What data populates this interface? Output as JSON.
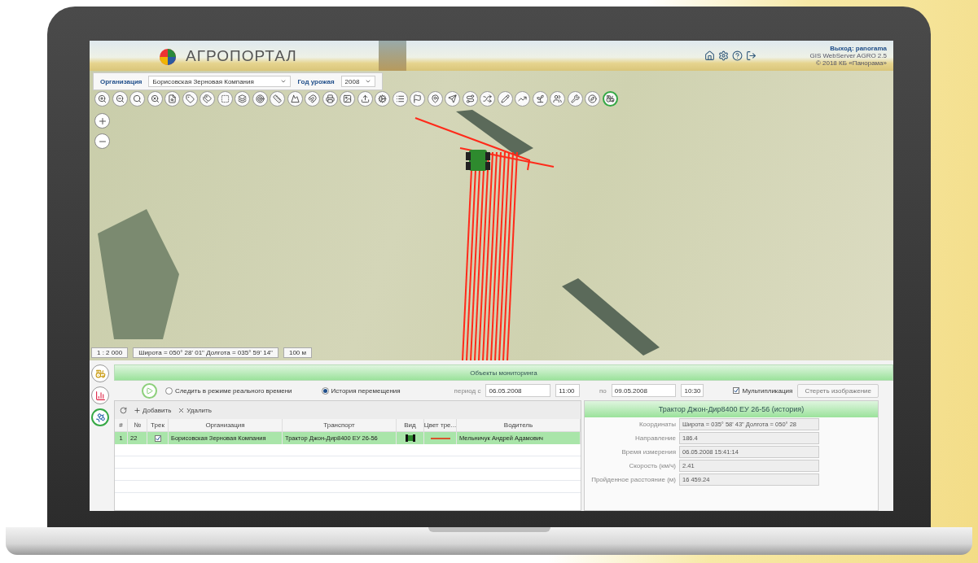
{
  "header": {
    "title": "АГРОПОРТАЛ",
    "logout": "Выход: panorama",
    "product": "GIS WebServer AGRO 2.5",
    "copyright": "© 2018 КБ «Панорама»"
  },
  "filters": [
    {
      "label": "Организация",
      "value": "Борисовская Зерновая Компания"
    },
    {
      "label": "Год урожая",
      "value": "2008"
    }
  ],
  "toolbar_tools": [
    {
      "selected": false
    },
    {
      "selected": false
    },
    {
      "selected": false
    },
    {
      "selected": false
    },
    {
      "selected": false
    },
    {
      "selected": false
    },
    {
      "selected": false
    },
    {
      "selected": false
    },
    {
      "selected": false
    },
    {
      "selected": false
    },
    {
      "selected": false
    },
    {
      "selected": false
    },
    {
      "selected": false
    },
    {
      "selected": false
    },
    {
      "selected": false
    },
    {
      "selected": false
    },
    {
      "selected": false
    },
    {
      "selected": false
    },
    {
      "selected": false
    },
    {
      "selected": false
    },
    {
      "selected": false
    },
    {
      "selected": false
    },
    {
      "selected": false
    },
    {
      "selected": false
    },
    {
      "selected": false
    },
    {
      "selected": false
    },
    {
      "selected": false
    },
    {
      "selected": false
    },
    {
      "selected": false
    },
    {
      "selected": true
    }
  ],
  "map": {
    "scale": "1 : 2 000",
    "coordinates": "Широта = 050° 28' 01\" Долгота = 035° 59' 14\"",
    "scale_bar": "100 м"
  },
  "side_tools": [
    {
      "selected": false
    },
    {
      "selected": false
    },
    {
      "selected": true
    }
  ],
  "monitoring": {
    "title": "Объекты мониторинга",
    "modes": [
      {
        "label": "Следить в режиме реального времени",
        "selected": false
      },
      {
        "label": "История перемещения",
        "selected": true
      }
    ],
    "from_label": "период с",
    "date_from": "06.05.2008",
    "time_from": "11:00",
    "to_label": "по",
    "date_to": "09.05.2008",
    "time_to": "10:30",
    "multiplication": {
      "label": "Мультипликация",
      "checked": true
    },
    "clear_button": "Стереть изображение"
  },
  "table": {
    "actions": [
      "Добавить",
      "Удалить"
    ],
    "columns": [
      "#",
      "№",
      "Трек",
      "Организация",
      "Транспорт",
      "Вид",
      "Цвет тре...",
      "Водитель"
    ],
    "rows": [
      {
        "index": "1",
        "number": "22",
        "track": true,
        "organization": "Борисовская Зерновая Компания",
        "transport": "Трактор Джон-Дир8400 ЕУ 26-56",
        "color": "#d9542c",
        "driver": "Мельничук Андрей Адамович",
        "selected": true
      }
    ]
  },
  "details": {
    "title": "Трактор Джон-Дир8400 ЕУ 26-56 (история)",
    "fields": [
      {
        "label": "Координаты",
        "value": "Широта = 035° 58' 43\"   Долгота = 050° 28"
      },
      {
        "label": "Направление",
        "value": "186.4"
      },
      {
        "label": "Время измерения",
        "value": "06.05.2008 15:41:14"
      },
      {
        "label": "Скорость (км/ч)",
        "value": "2.41"
      },
      {
        "label": "Пройденное расстояние (м)",
        "value": "16 459.24"
      }
    ]
  }
}
